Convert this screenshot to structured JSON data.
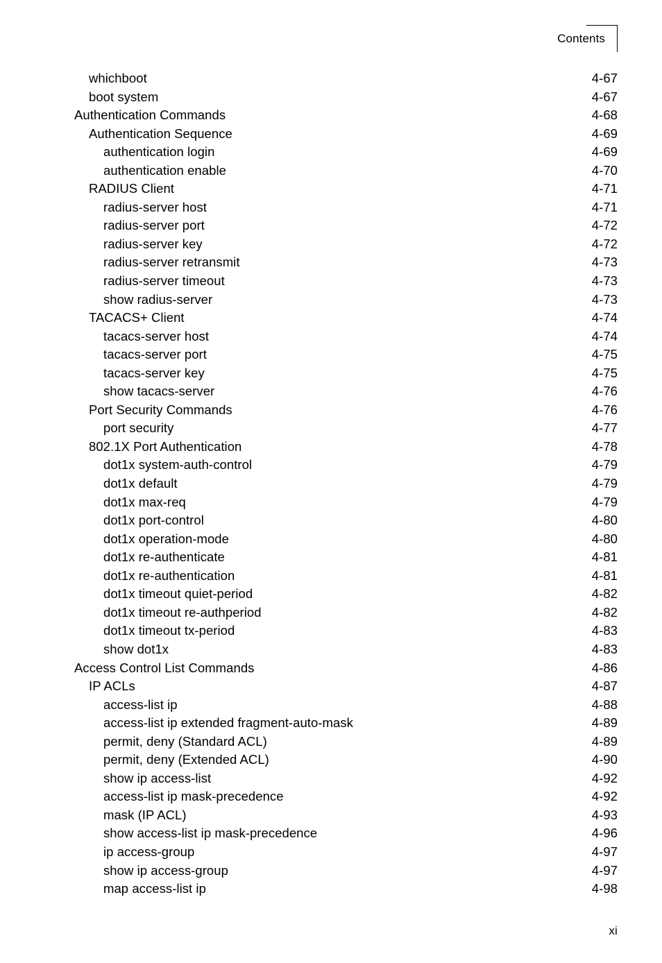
{
  "header": {
    "title": "Contents"
  },
  "footer": {
    "page_label": "xi"
  },
  "toc": {
    "entries": [
      {
        "title": "whichboot",
        "page": "4-67",
        "level": 2
      },
      {
        "title": "boot system",
        "page": "4-67",
        "level": 2
      },
      {
        "title": "Authentication Commands",
        "page": "4-68",
        "level": 1
      },
      {
        "title": "Authentication Sequence",
        "page": "4-69",
        "level": 2
      },
      {
        "title": "authentication login",
        "page": "4-69",
        "level": 3
      },
      {
        "title": "authentication enable",
        "page": "4-70",
        "level": 3
      },
      {
        "title": "RADIUS Client",
        "page": "4-71",
        "level": 2
      },
      {
        "title": "radius-server host",
        "page": "4-71",
        "level": 3
      },
      {
        "title": "radius-server port",
        "page": "4-72",
        "level": 3
      },
      {
        "title": "radius-server key",
        "page": "4-72",
        "level": 3
      },
      {
        "title": "radius-server retransmit",
        "page": "4-73",
        "level": 3
      },
      {
        "title": "radius-server timeout",
        "page": "4-73",
        "level": 3
      },
      {
        "title": "show radius-server",
        "page": "4-73",
        "level": 3
      },
      {
        "title": "TACACS+ Client",
        "page": "4-74",
        "level": 2
      },
      {
        "title": "tacacs-server host",
        "page": "4-74",
        "level": 3
      },
      {
        "title": "tacacs-server port",
        "page": "4-75",
        "level": 3
      },
      {
        "title": "tacacs-server key",
        "page": "4-75",
        "level": 3
      },
      {
        "title": "show tacacs-server",
        "page": "4-76",
        "level": 3
      },
      {
        "title": "Port Security Commands",
        "page": "4-76",
        "level": 2
      },
      {
        "title": "port security",
        "page": "4-77",
        "level": 3
      },
      {
        "title": "802.1X Port Authentication",
        "page": "4-78",
        "level": 2
      },
      {
        "title": "dot1x system-auth-control",
        "page": "4-79",
        "level": 3
      },
      {
        "title": "dot1x default",
        "page": "4-79",
        "level": 3
      },
      {
        "title": "dot1x max-req",
        "page": "4-79",
        "level": 3
      },
      {
        "title": "dot1x port-control",
        "page": "4-80",
        "level": 3
      },
      {
        "title": "dot1x operation-mode",
        "page": "4-80",
        "level": 3
      },
      {
        "title": "dot1x re-authenticate",
        "page": "4-81",
        "level": 3
      },
      {
        "title": "dot1x re-authentication",
        "page": "4-81",
        "level": 3
      },
      {
        "title": "dot1x timeout quiet-period",
        "page": "4-82",
        "level": 3
      },
      {
        "title": "dot1x timeout re-authperiod",
        "page": "4-82",
        "level": 3
      },
      {
        "title": "dot1x timeout tx-period",
        "page": "4-83",
        "level": 3
      },
      {
        "title": "show dot1x",
        "page": "4-83",
        "level": 3
      },
      {
        "title": "Access Control List Commands",
        "page": "4-86",
        "level": 1
      },
      {
        "title": "IP ACLs",
        "page": "4-87",
        "level": 2
      },
      {
        "title": "access-list ip",
        "page": "4-88",
        "level": 3
      },
      {
        "title": "access-list ip extended fragment-auto-mask",
        "page": "4-89",
        "level": 3
      },
      {
        "title": "permit, deny (Standard ACL)",
        "page": "4-89",
        "level": 3
      },
      {
        "title": "permit, deny (Extended ACL)",
        "page": "4-90",
        "level": 3
      },
      {
        "title": "show ip access-list",
        "page": "4-92",
        "level": 3
      },
      {
        "title": "access-list ip mask-precedence",
        "page": "4-92",
        "level": 3
      },
      {
        "title": "mask (IP ACL)",
        "page": "4-93",
        "level": 3
      },
      {
        "title": "show access-list ip mask-precedence",
        "page": "4-96",
        "level": 3
      },
      {
        "title": "ip access-group",
        "page": "4-97",
        "level": 3
      },
      {
        "title": "show ip access-group",
        "page": "4-97",
        "level": 3
      },
      {
        "title": "map access-list ip",
        "page": "4-98",
        "level": 3
      }
    ]
  }
}
